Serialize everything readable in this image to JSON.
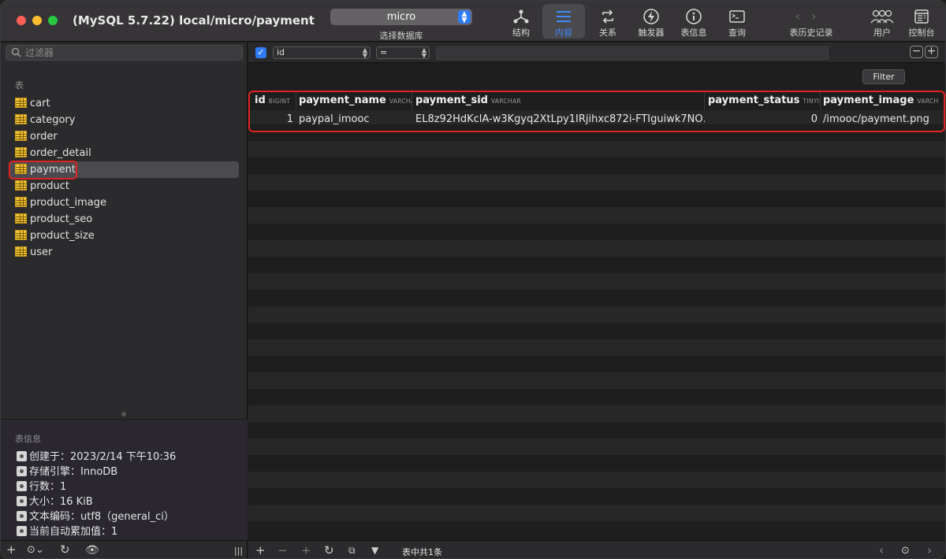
{
  "window": {
    "title": "(MySQL 5.7.22) local/micro/payment"
  },
  "toolbar": {
    "database_select": {
      "value": "micro",
      "caption": "选择数据库"
    },
    "buttons": [
      {
        "label": "结构",
        "icon": "structure-icon"
      },
      {
        "label": "内容",
        "icon": "content-icon",
        "active": true
      },
      {
        "label": "关系",
        "icon": "relations-icon"
      },
      {
        "label": "触发器",
        "icon": "triggers-icon"
      },
      {
        "label": "表信息",
        "icon": "info-icon"
      },
      {
        "label": "查询",
        "icon": "query-icon"
      }
    ],
    "history": {
      "label": "表历史记录"
    },
    "users": {
      "label": "用户"
    },
    "console": {
      "label": "控制台"
    }
  },
  "sidebar": {
    "filter_placeholder": "过滤器",
    "section_label": "表",
    "tables": [
      "cart",
      "category",
      "order",
      "order_detail",
      "payment",
      "product",
      "product_image",
      "product_seo",
      "product_size",
      "user"
    ],
    "selected_table": "payment",
    "info_label": "表信息",
    "info": [
      "创建于：2023/2/14 下午10:36",
      "存储引擎：InnoDB",
      "行数：1",
      "大小：16 KiB",
      "文本编码：utf8（general_ci）",
      "当前自动累加值：1"
    ]
  },
  "filter_bar": {
    "field": "id",
    "operator": "=",
    "value": "",
    "filter_button": "Filter"
  },
  "table": {
    "columns": [
      {
        "name": "id",
        "type": "BIGINT"
      },
      {
        "name": "payment_name",
        "type": "VARCHAR"
      },
      {
        "name": "payment_sid",
        "type": "VARCHAR"
      },
      {
        "name": "payment_status",
        "type": "TINYINT"
      },
      {
        "name": "payment_image",
        "type": "VARCHAR"
      }
    ],
    "rows": [
      [
        "1",
        "paypal_imooc",
        "EL8z92HdKclA-w3Kgyq2XtLpy1IRjihxc872i-FTIguiwk7NO…",
        "0",
        "/imooc/payment.png"
      ]
    ]
  },
  "status": {
    "row_count": "表中共1条"
  }
}
